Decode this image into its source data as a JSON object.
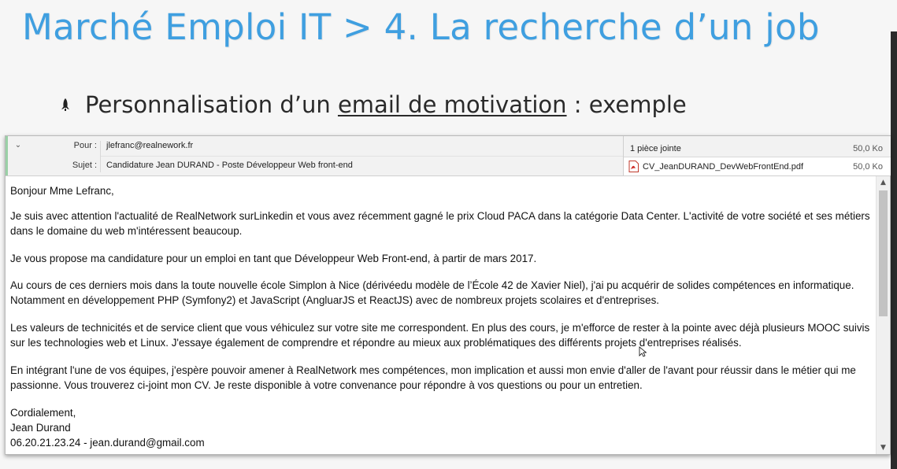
{
  "slide": {
    "title": "Marché Emploi IT > 4. La recherche d’un job",
    "bullet_pre": "Personnalisation d’un ",
    "bullet_underlined": "email de motivation",
    "bullet_post": " : exemple",
    "bullet_icon": "rocket-bullet-icon"
  },
  "email": {
    "to_label": "Pour :",
    "to_value": "jlefranc@realnework.fr",
    "subject_label": "Sujet :",
    "subject_value": "Candidature Jean DURAND - Poste Développeur Web front-end",
    "attachments_header": "1 pièce jointe",
    "attachments_total_size": "50,0 Ko",
    "attachment_name": "CV_JeanDURAND_DevWebFrontEnd.pdf",
    "attachment_size": "50,0 Ko",
    "body": {
      "greeting": "Bonjour Mme Lefranc,",
      "p1": "Je suis avec attention l'actualité de RealNetwork surLinkedin et vous avez récemment gagné le prix Cloud PACA dans la catégorie Data Center. L'activité de votre société et ses métiers dans le domaine du web m'intéressent beaucoup.",
      "p2": "Je vous propose ma candidature pour un emploi en tant que Développeur Web Front-end, à partir de mars 2017.",
      "p3": "Au cours de ces derniers mois dans la toute nouvelle école Simplon à Nice (dérivéedu modèle de l’École 42 de Xavier Niel), j'ai pu acquérir de solides compétences en informatique. Notamment en développement PHP (Symfony2) et JavaScript (AngluarJS et ReactJS) avec de nombreux projets scolaires et d'entreprises.",
      "p4": "Les valeurs de technicités et de service client que vous véhiculez sur votre site me correspondent. En plus des cours, je m'efforce de rester à la pointe avec déjà plusieurs MOOC suivis sur les technologies web et Linux. J'essaye également de comprendre et répondre au mieux aux problématiques des différents projets d'entreprises réalisés.",
      "p5": "En intégrant l'une de vos équipes, j'espère pouvoir amener à RealNetwork mes compétences, mon implication et aussi mon envie d'aller de l'avant pour réussir dans le métier qui me passionne. Vous trouverez ci-joint mon CV. Je reste disponible à votre convenance pour répondre à vos questions ou pour un entretien.",
      "closing": "Cordialement,",
      "signature_name": "Jean Durand",
      "signature_contact": "06.20.21.23.24 - jean.durand@gmail.com"
    }
  },
  "colors": {
    "title": "#3f9fe0",
    "accent": "#9ad0a6"
  }
}
